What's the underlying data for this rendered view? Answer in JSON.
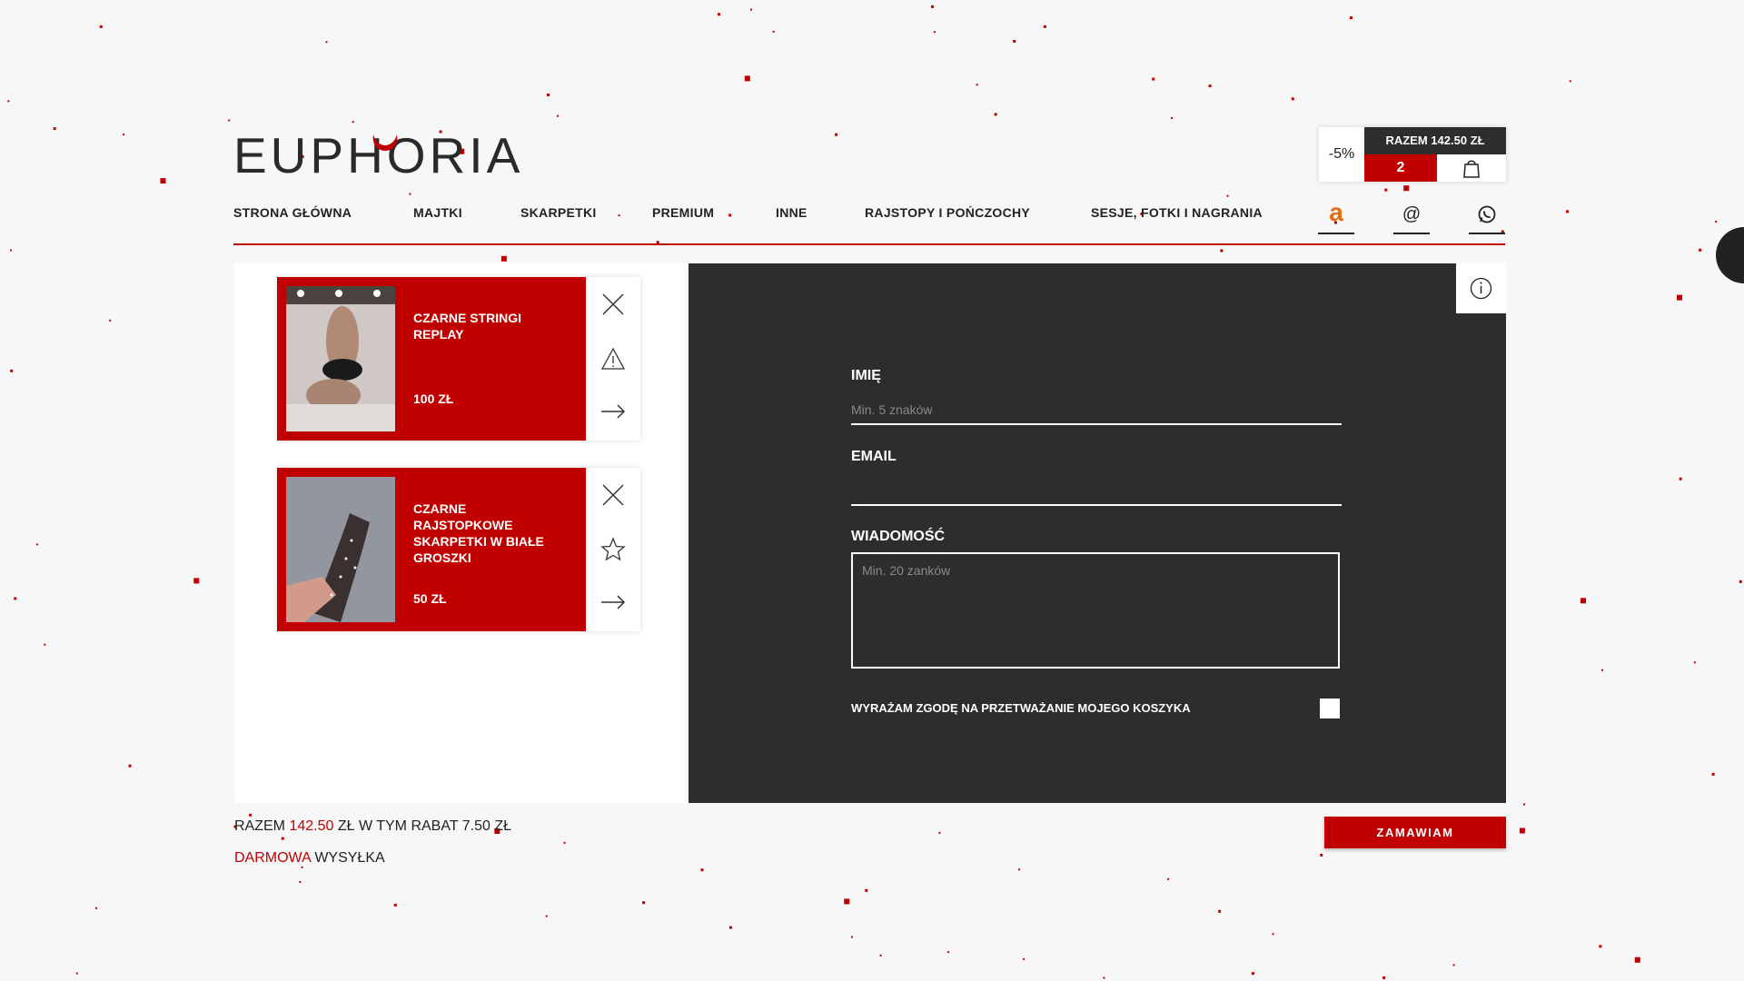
{
  "brand": {
    "logo_text": "EUPHORIA",
    "accent": "#c00000",
    "dark": "#2d2d2d"
  },
  "nav": {
    "items": [
      {
        "label": "STRONA GŁÓWNA"
      },
      {
        "label": "MAJTKI"
      },
      {
        "label": "SKARPETKI"
      },
      {
        "label": "PREMIUM"
      },
      {
        "label": "INNE"
      },
      {
        "label": "RAJSTOPY I POŃCZOCHY"
      },
      {
        "label": "SESJE, FOTKI I NAGRANIA"
      }
    ],
    "icons": [
      {
        "name": "amazon-icon",
        "glyph": "a"
      },
      {
        "name": "email-icon",
        "glyph": "@"
      },
      {
        "name": "whatsapp-icon",
        "glyph": "whatsapp"
      }
    ]
  },
  "cart": {
    "discount": "-5%",
    "total": "RAZEM 142.50 ZŁ",
    "count": "2",
    "bag_icon": "shopping-bag-icon"
  },
  "items": [
    {
      "title": "CZARNE STRINGI REPLAY",
      "price": "100 ZŁ",
      "actions": [
        "close-icon",
        "warning-icon",
        "arrow-right-icon"
      ]
    },
    {
      "title": "CZARNE RAJSTOPKOWE SKARPETKI W BIAŁE GROSZKI",
      "price": "50 ZŁ",
      "actions": [
        "close-icon",
        "star-icon",
        "arrow-right-icon"
      ]
    }
  ],
  "form": {
    "name_label": "IMIĘ",
    "name_placeholder": "Min. 5 znaków",
    "email_label": "EMAIL",
    "email_placeholder": "",
    "message_label": "WIADOMOŚĆ",
    "message_placeholder": "Min. 20 zanków",
    "consent_label": "WYRAŻAM ZGODĘ NA PRZETWAŻANIE MOJEGO KOSZYKA",
    "consent_checked": false
  },
  "summary": {
    "prefix": "RAZEM",
    "total": "142.50",
    "suffix": "ZŁ W TYM RABAT 7.50 ZŁ",
    "shipping_highlight": "DARMOWA",
    "shipping_rest": "WYSYŁKA"
  },
  "order_button": "ZAMAWIAM"
}
